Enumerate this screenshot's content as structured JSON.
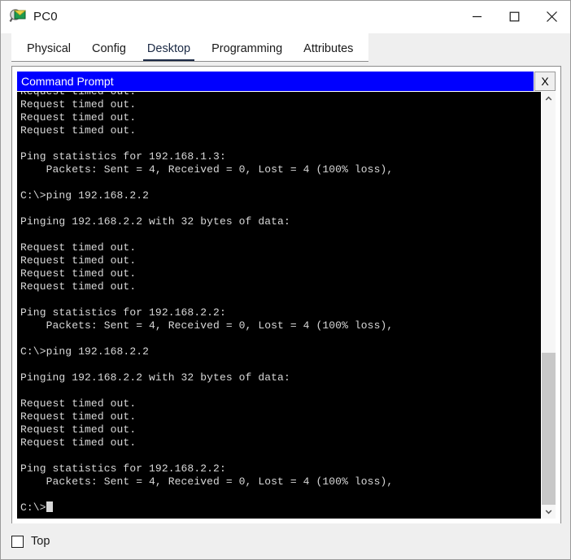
{
  "window": {
    "title": "PC0",
    "icon": "packet-tracer-device-icon",
    "controls": {
      "minimize": "minimize-icon",
      "maximize": "maximize-icon",
      "close": "close-icon"
    }
  },
  "tabs": [
    {
      "label": "Physical",
      "active": false
    },
    {
      "label": "Config",
      "active": false
    },
    {
      "label": "Desktop",
      "active": true
    },
    {
      "label": "Programming",
      "active": false
    },
    {
      "label": "Attributes",
      "active": false
    }
  ],
  "command_prompt": {
    "title": "Command Prompt",
    "close_label": "X",
    "title_color": "#0000ff",
    "background": "#000000",
    "text_color": "#d8d8d8",
    "lines": [
      "Request timed out.",
      "Request timed out.",
      "Request timed out.",
      "Request timed out.",
      "",
      "Ping statistics for 192.168.1.3:",
      "    Packets: Sent = 4, Received = 0, Lost = 4 (100% loss),",
      "",
      "C:\\>ping 192.168.2.2",
      "",
      "Pinging 192.168.2.2 with 32 bytes of data:",
      "",
      "Request timed out.",
      "Request timed out.",
      "Request timed out.",
      "Request timed out.",
      "",
      "Ping statistics for 192.168.2.2:",
      "    Packets: Sent = 4, Received = 0, Lost = 4 (100% loss),",
      "",
      "C:\\>ping 192.168.2.2",
      "",
      "Pinging 192.168.2.2 with 32 bytes of data:",
      "",
      "Request timed out.",
      "Request timed out.",
      "Request timed out.",
      "Request timed out.",
      "",
      "Ping statistics for 192.168.2.2:",
      "    Packets: Sent = 4, Received = 0, Lost = 4 (100% loss),",
      ""
    ],
    "prompt": "C:\\>",
    "scrollbar": {
      "up_icon": "chevron-up-icon",
      "down_icon": "chevron-down-icon",
      "thumb_position_percent": 62
    }
  },
  "bottom": {
    "top_checkbox_label": "Top",
    "top_checkbox_checked": false
  }
}
